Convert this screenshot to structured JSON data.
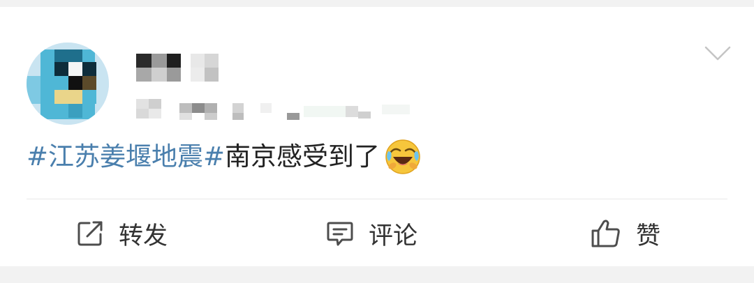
{
  "post": {
    "hashtag": "#江苏姜堰地震#",
    "text": "南京感受到了",
    "emoji": "laughing-crying-emoji"
  },
  "actions": {
    "repost_label": "转发",
    "comment_label": "评论",
    "like_label": "赞"
  },
  "icons": {
    "repost": "share-box-icon",
    "comment": "comment-bubble-icon",
    "like": "thumbs-up-icon",
    "menu": "chevron-down-icon"
  },
  "colors": {
    "hashtag": "#4a7fad",
    "background": "#f2f2f2",
    "card": "#ffffff"
  }
}
